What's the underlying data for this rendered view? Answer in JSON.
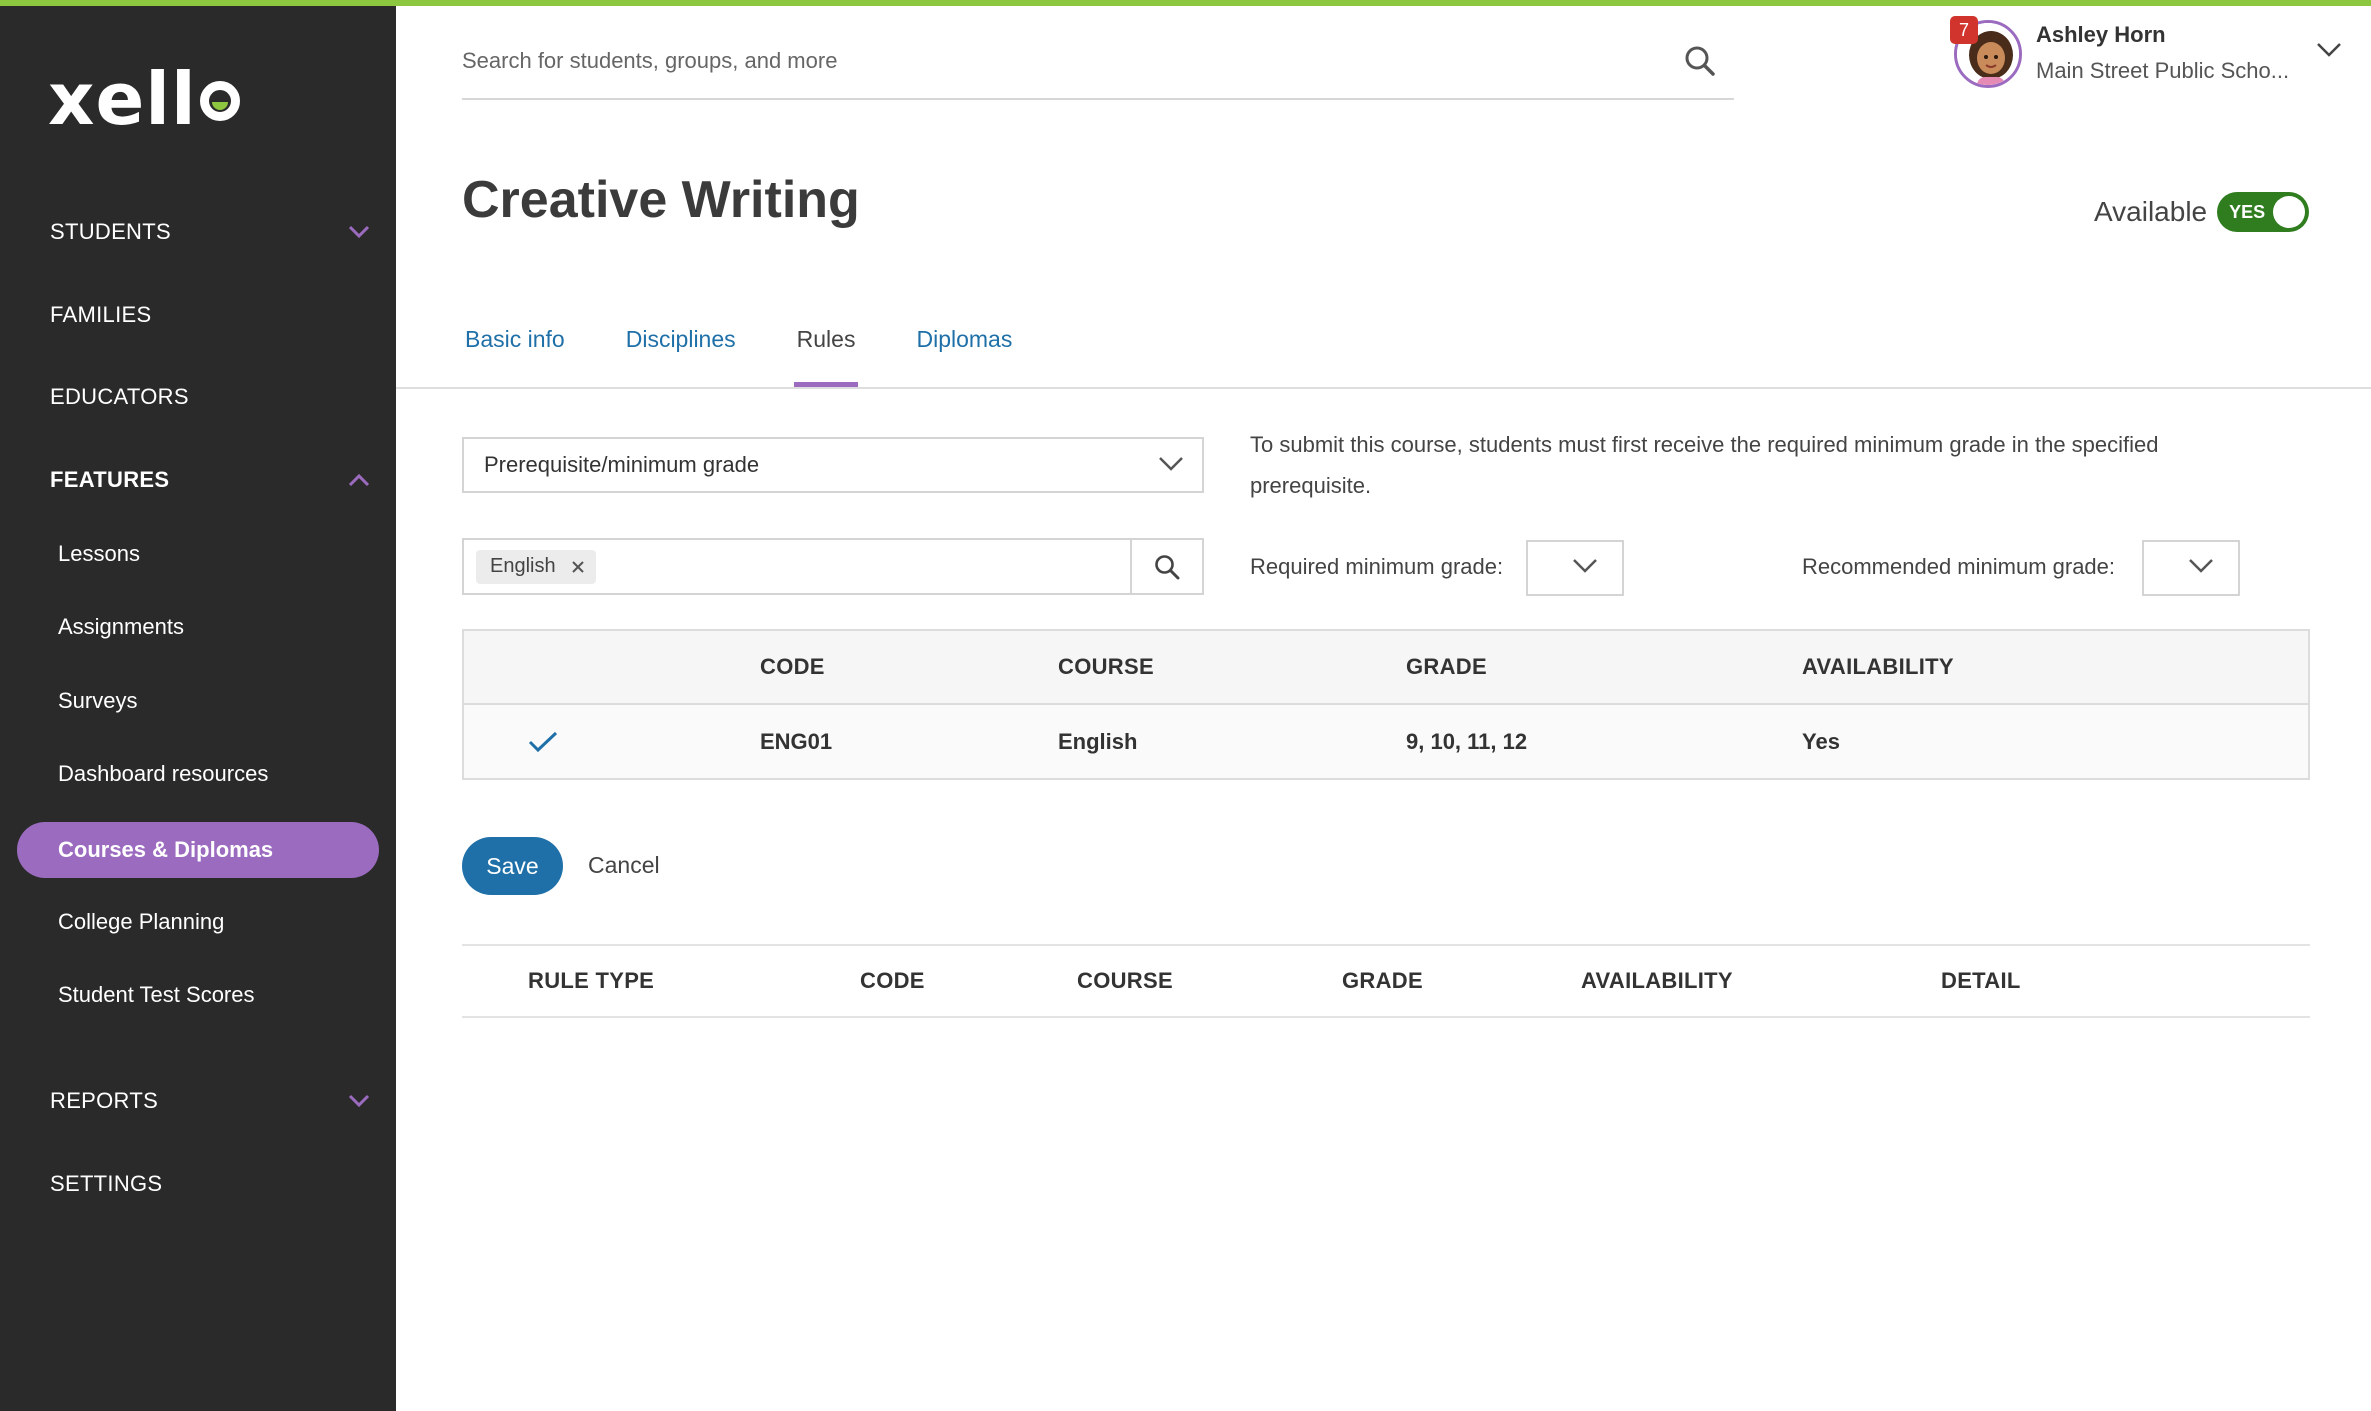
{
  "app": {
    "brand": "xello",
    "accent": "#9b6bc0",
    "brand_green": "#8dc63f",
    "link_blue": "#1f70a8"
  },
  "sidebar": {
    "sections": [
      {
        "label": "STUDENTS",
        "chevron": "down"
      },
      {
        "label": "FAMILIES"
      },
      {
        "label": "EDUCATORS"
      },
      {
        "label": "FEATURES",
        "chevron": "up"
      },
      {
        "label": "REPORTS",
        "chevron": "down"
      },
      {
        "label": "SETTINGS"
      }
    ],
    "feature_items": [
      {
        "label": "Lessons"
      },
      {
        "label": "Assignments"
      },
      {
        "label": "Surveys"
      },
      {
        "label": "Dashboard resources"
      },
      {
        "label": "Courses & Diplomas",
        "active": true
      },
      {
        "label": "College Planning"
      },
      {
        "label": "Student Test Scores"
      }
    ]
  },
  "header": {
    "search_placeholder": "Search for students, groups, and more",
    "user": {
      "name": "Ashley Horn",
      "school": "Main Street Public Scho...",
      "notifications": "7"
    }
  },
  "page": {
    "title": "Creative Writing",
    "available_label": "Available",
    "available_toggle": "YES",
    "tabs": [
      {
        "label": "Basic info"
      },
      {
        "label": "Disciplines"
      },
      {
        "label": "Rules",
        "active": true
      },
      {
        "label": "Diplomas"
      }
    ]
  },
  "rule_form": {
    "rule_type": "Prerequisite/minimum grade",
    "description": "To submit this course, students must first receive the required minimum grade in the specified prerequisite.",
    "course_chip": "English",
    "required_grade_label": "Required minimum grade:",
    "recommended_grade_label": "Recommended minimum grade:",
    "results": {
      "columns": [
        "CODE",
        "COURSE",
        "GRADE",
        "AVAILABILITY"
      ],
      "rows": [
        {
          "selected": true,
          "code": "ENG01",
          "course": "English",
          "grade": "9, 10, 11, 12",
          "availability": "Yes"
        }
      ]
    },
    "save_label": "Save",
    "cancel_label": "Cancel"
  },
  "rules_table": {
    "columns": [
      "RULE TYPE",
      "CODE",
      "COURSE",
      "GRADE",
      "AVAILABILITY",
      "DETAIL"
    ]
  }
}
